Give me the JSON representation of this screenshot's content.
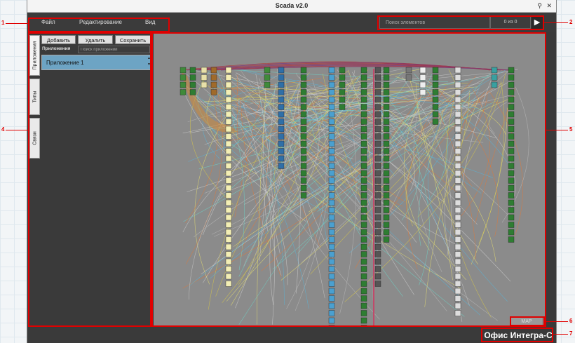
{
  "window": {
    "title": "Scada v2.0",
    "pin_icon": "pin-icon",
    "close_label": "✕"
  },
  "menu": {
    "file": "Файл",
    "edit": "Редактирование",
    "view": "Вид"
  },
  "search": {
    "placeholder": "Поиск элементов",
    "count": "0 из 0",
    "go_icon": "play-icon"
  },
  "side_tabs": [
    "Приложения",
    "Типы",
    "Связи"
  ],
  "apps_panel": {
    "add": "Добавить",
    "delete": "Удалить",
    "save": "Сохранить",
    "label": "Приложения",
    "search_placeholder": "Поиск приложений",
    "items": [
      "Приложение 1"
    ]
  },
  "canvas": {
    "map_label": "MAP"
  },
  "status": {
    "office": "Офис Интегра-С"
  },
  "callouts": [
    "1",
    "2",
    "4",
    "5",
    "6",
    "7"
  ],
  "colors": {
    "highlight": "#e00000",
    "canvas_bg": "#8b8b8b",
    "panel_bg": "#3a3a3a"
  }
}
